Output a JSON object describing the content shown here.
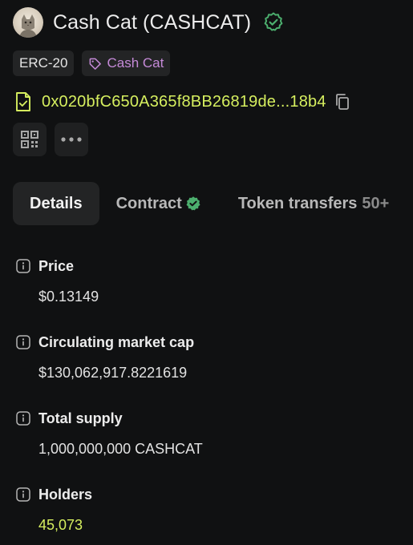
{
  "token": {
    "title": "Cash Cat (CASHCAT)",
    "avatar_icon": "cat-avatar",
    "verified_icon": "verified-badge-icon"
  },
  "tags": {
    "standard": "ERC-20",
    "name": "Cash Cat"
  },
  "address": {
    "text": "0x020bfC650A365f8BB26819de...18b4"
  },
  "actions": {
    "qr_icon": "qr-code-icon",
    "more_icon": "more-horizontal-icon"
  },
  "tabs": {
    "details": "Details",
    "contract": "Contract",
    "transfers": "Token transfers",
    "transfers_count": "50+"
  },
  "details": {
    "price_label": "Price",
    "price_value": "$0.13149",
    "mcap_label": "Circulating market cap",
    "mcap_value": "$130,062,917.8221619",
    "supply_label": "Total supply",
    "supply_value": "1,000,000,000 CASHCAT",
    "holders_label": "Holders",
    "holders_value": "45,073"
  },
  "colors": {
    "background": "#101112",
    "accent_link": "#d6ef5f",
    "tag_purple": "#c58ad8",
    "verified_green": "#4caf6e",
    "surface": "#232425"
  }
}
